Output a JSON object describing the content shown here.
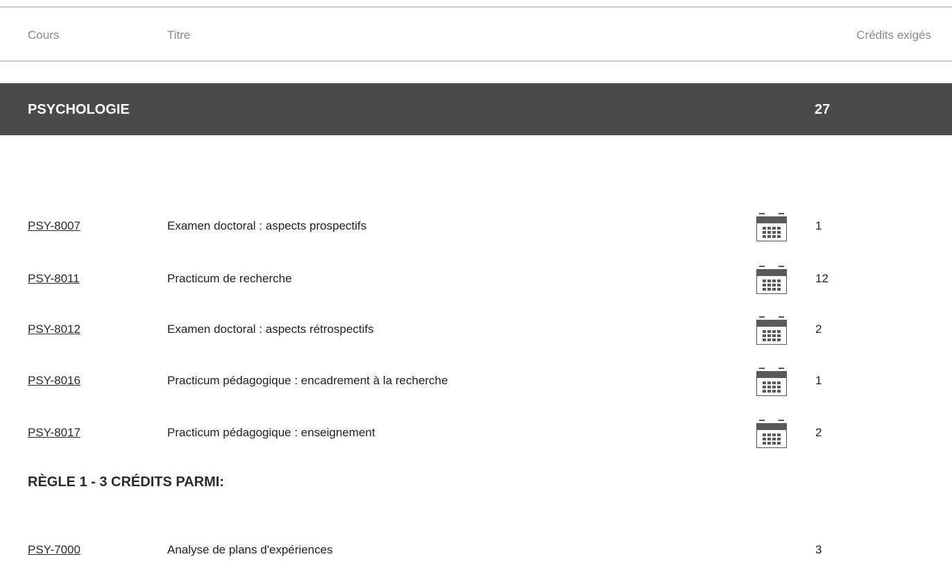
{
  "table_header": {
    "cours": "Cours",
    "titre": "Titre",
    "credits": "Crédits exigés"
  },
  "section": {
    "title": "PSYCHOLOGIE",
    "credits": "27"
  },
  "courses": [
    {
      "code": "PSY-8007",
      "title": "Examen doctoral : aspects prospectifs",
      "credits": "1",
      "icon": "calendar-icon"
    },
    {
      "code": "PSY-8011",
      "title": "Practicum de recherche",
      "credits": "12",
      "icon": "calendar-icon"
    },
    {
      "code": "PSY-8012",
      "title": "Examen doctoral : aspects rétrospectifs",
      "credits": "2",
      "icon": "calendar-icon"
    },
    {
      "code": "PSY-8016",
      "title": "Practicum pédagogique : encadrement à la recherche",
      "credits": "1",
      "icon": "calendar-icon"
    },
    {
      "code": "PSY-8017",
      "title": "Practicum pédagogique : enseignement",
      "credits": "2",
      "icon": "calendar-icon"
    }
  ],
  "rule1": {
    "heading": "RÈGLE 1 - 3 CRÉDITS PARMI:",
    "courses": [
      {
        "code": "PSY-7000",
        "title": "Analyse de plans d'expériences",
        "credits": "3"
      }
    ]
  },
  "colors": {
    "section_bar": "#4a4a4a",
    "rule_line": "#cfcfcf",
    "header_text": "#8a8a8a",
    "icon": "#5a5a5a"
  }
}
